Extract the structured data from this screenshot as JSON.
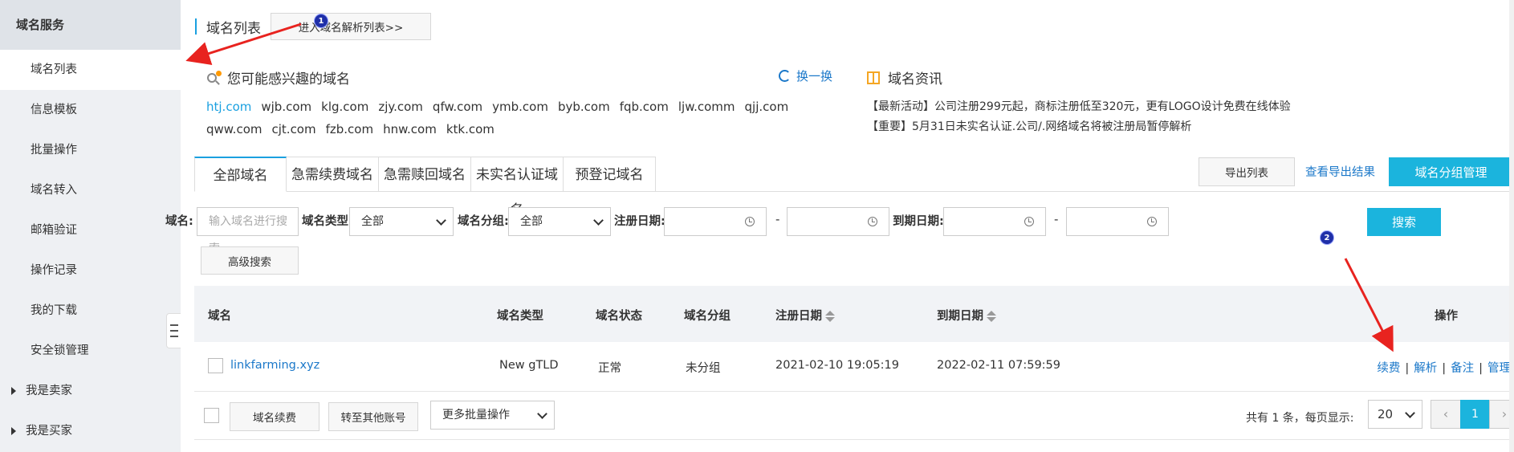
{
  "sidebar": {
    "header": "域名服务",
    "items": [
      {
        "label": "域名列表",
        "active": true
      },
      {
        "label": "信息模板"
      },
      {
        "label": "批量操作"
      },
      {
        "label": "域名转入"
      },
      {
        "label": "邮箱验证"
      },
      {
        "label": "操作记录"
      },
      {
        "label": "我的下载"
      },
      {
        "label": "安全锁管理"
      }
    ],
    "expandable": [
      {
        "label": "我是卖家"
      },
      {
        "label": "我是买家"
      }
    ]
  },
  "breadcrumb": {
    "title": "域名列表",
    "goto_button": "进入域名解析列表>>"
  },
  "suggest": {
    "title": "您可能感兴趣的域名",
    "swap_label": "换一换",
    "domains": [
      "htj.com",
      "wjb.com",
      "klg.com",
      "zjy.com",
      "qfw.com",
      "ymb.com",
      "byb.com",
      "fqb.com",
      "ljw.comm",
      "qjj.com",
      "qww.com",
      "cjt.com",
      "fzb.com",
      "hnw.com",
      "ktk.com"
    ]
  },
  "news": {
    "title": "域名资讯",
    "lines": [
      "【最新活动】公司注册299元起，商标注册低至320元，更有LOGO设计免费在线体验",
      "【重要】5月31日未实名认证.公司/.网络域名将被注册局暂停解析"
    ]
  },
  "tabs": [
    "全部域名",
    "急需续费域名",
    "急需赎回域名",
    "未实名认证域名",
    "预登记域名"
  ],
  "toolbar": {
    "export_list": "导出列表",
    "view_export": "查看导出结果",
    "group_manage": "域名分组管理"
  },
  "filter": {
    "domain_label": "域名:",
    "domain_placeholder": "输入域名进行搜索",
    "type_label": "域名类型:",
    "type_value": "全部",
    "group_label": "域名分组:",
    "group_value": "全部",
    "reg_date_label": "注册日期:",
    "exp_date_label": "到期日期:",
    "dash": "-",
    "search_button": "搜索",
    "advanced_button": "高级搜索"
  },
  "table": {
    "headers": {
      "domain": "域名",
      "type": "域名类型",
      "status": "域名状态",
      "group": "域名分组",
      "reg_date": "注册日期",
      "exp_date": "到期日期",
      "ops": "操作"
    },
    "rows": [
      {
        "domain": "linkfarming.xyz",
        "type": "New gTLD",
        "status": "正常",
        "group": "未分组",
        "reg_date": "2021-02-10 19:05:19",
        "exp_date": "2022-02-11 07:59:59",
        "ops": [
          "续费",
          "解析",
          "备注",
          "管理"
        ]
      }
    ]
  },
  "footer": {
    "renew_button": "域名续费",
    "transfer_button": "转至其他账号",
    "more_batch": "更多批量操作",
    "page_info": "共有 1 条，每页显示:",
    "page_size": "20",
    "prev": "‹",
    "current_page": "1",
    "next": "›"
  },
  "annotations": {
    "badge1": "1",
    "badge2": "2",
    "arrow_color": "#e8231f"
  },
  "colors": {
    "accent": "#1bb4dd",
    "link": "#1b78c9",
    "sidebar_bg": "#eef0f3"
  }
}
